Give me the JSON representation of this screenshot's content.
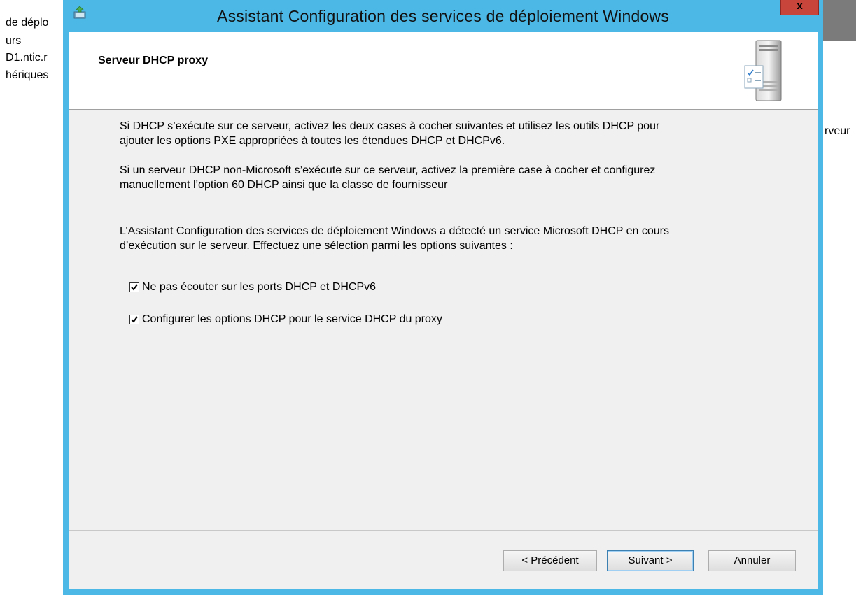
{
  "background": {
    "left_items": [
      "de déplo",
      "urs",
      "D1.ntic.r",
      "hériques"
    ],
    "right_text": "rveur"
  },
  "dialog": {
    "title": "Assistant Configuration des services de déploiement Windows",
    "close_label": "x",
    "header_title": "Serveur DHCP proxy",
    "info_paragraphs": [
      "Si DHCP s’exécute sur ce serveur, activez les deux cases à cocher suivantes et utilisez les outils DHCP pour ajouter les options PXE appropriées à toutes les étendues DHCP et DHCPv6.",
      "Si un serveur DHCP non-Microsoft s’exécute sur ce serveur, activez la première case à cocher et configurez manuellement l’option 60 DHCP ainsi que la classe de fournisseur"
    ],
    "detection_text": "L’Assistant Configuration des services de déploiement Windows a détecté un service Microsoft DHCP en cours d’exécution sur le serveur. Effectuez une sélection parmi les options suivantes :",
    "options": [
      {
        "label": "Ne pas écouter sur les ports DHCP et DHCPv6",
        "checked": true
      },
      {
        "label": "Configurer les options DHCP pour le service DHCP du proxy",
        "checked": true
      }
    ],
    "buttons": {
      "previous": "< Précédent",
      "next": "Suivant >",
      "cancel": "Annuler"
    }
  },
  "colors": {
    "window_frame": "#4cb8e6",
    "close_button": "#c7453b",
    "client_bg": "#f0f0f0"
  }
}
